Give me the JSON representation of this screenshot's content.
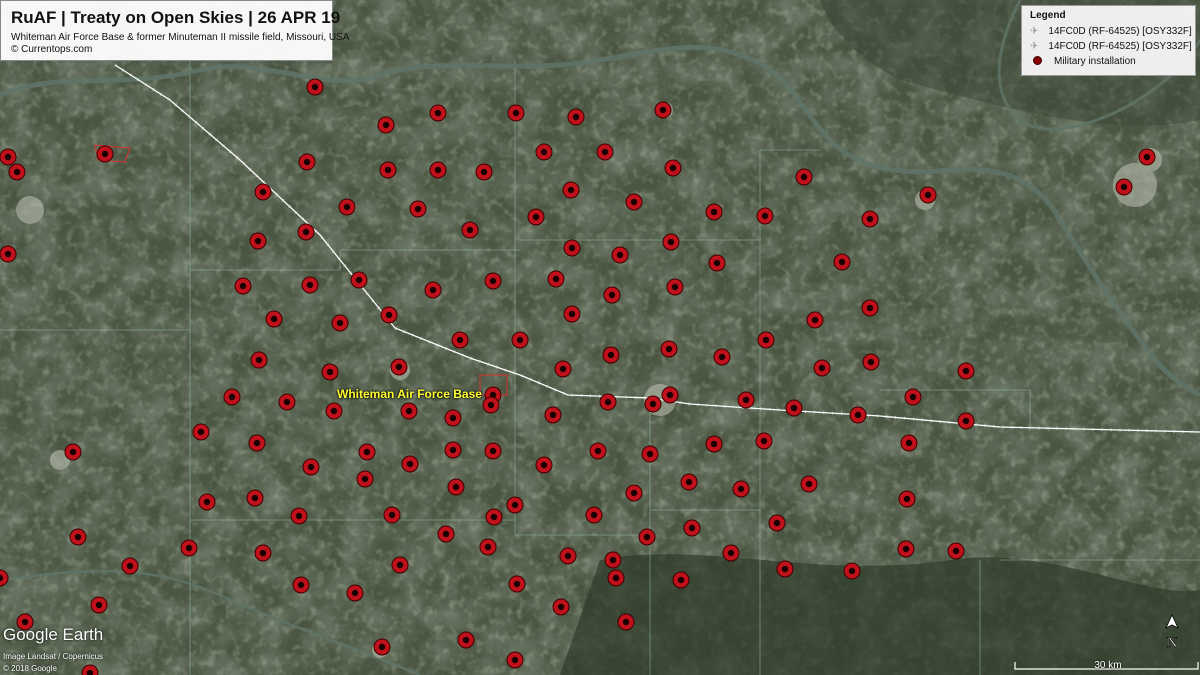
{
  "header": {
    "title": "RuAF | Treaty on Open Skies | 26 APR 19",
    "subtitle": "Whiteman Air Force Base & former Minuteman II missile field, Missouri, USA",
    "credit": "© Currentops.com"
  },
  "legend": {
    "title": "Legend",
    "items": [
      {
        "label": "14FC0D (RF-64525) [OSY332F]",
        "icon": "aircraft-icon"
      },
      {
        "label": "14FC0D (RF-64525) [OSY332F]",
        "icon": "aircraft-outline-icon"
      },
      {
        "label": "Military installation",
        "icon": "installation-icon"
      }
    ]
  },
  "map": {
    "base_label": "Whiteman Air Force Base",
    "logo": "Google Earth",
    "imagery_credit": "Image Landsat / Copernicus",
    "copyright": "© 2018 Google",
    "scale_label": "30 km",
    "north_label": "N",
    "colors": {
      "marker_fill": "#c0101a",
      "marker_border": "#3a0000",
      "track": "#ffffff",
      "label": "#ffff33"
    }
  }
}
